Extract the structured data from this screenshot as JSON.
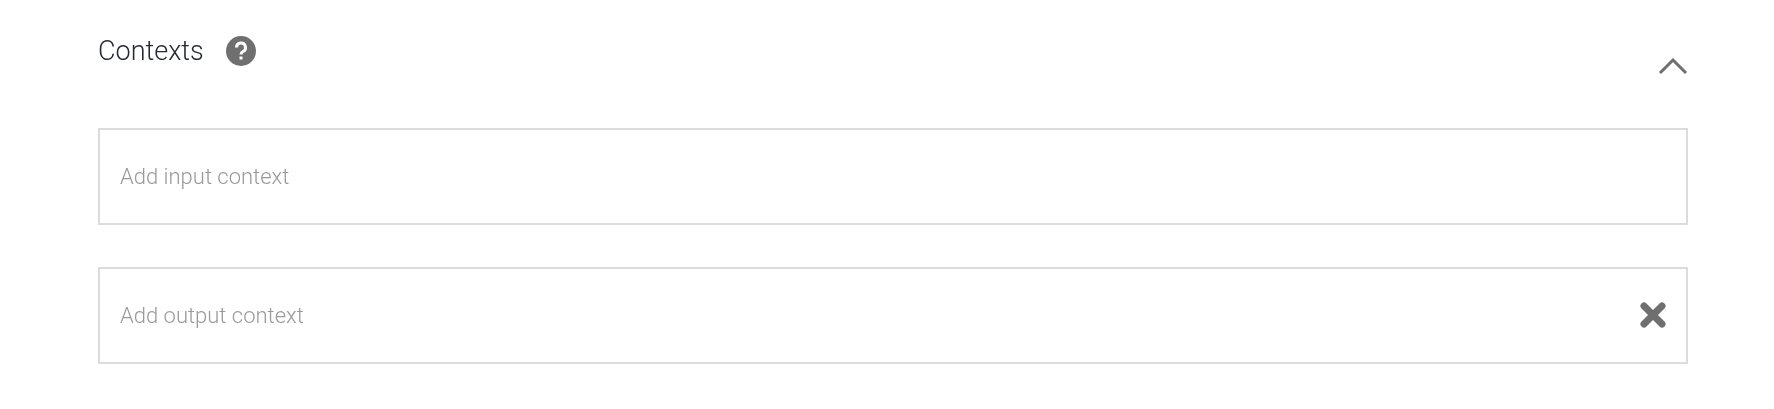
{
  "section": {
    "title": "Contexts",
    "expanded": true
  },
  "fields": [
    {
      "placeholder": "Add input context",
      "clearable": false
    },
    {
      "placeholder": "Add output context",
      "clearable": true
    }
  ]
}
